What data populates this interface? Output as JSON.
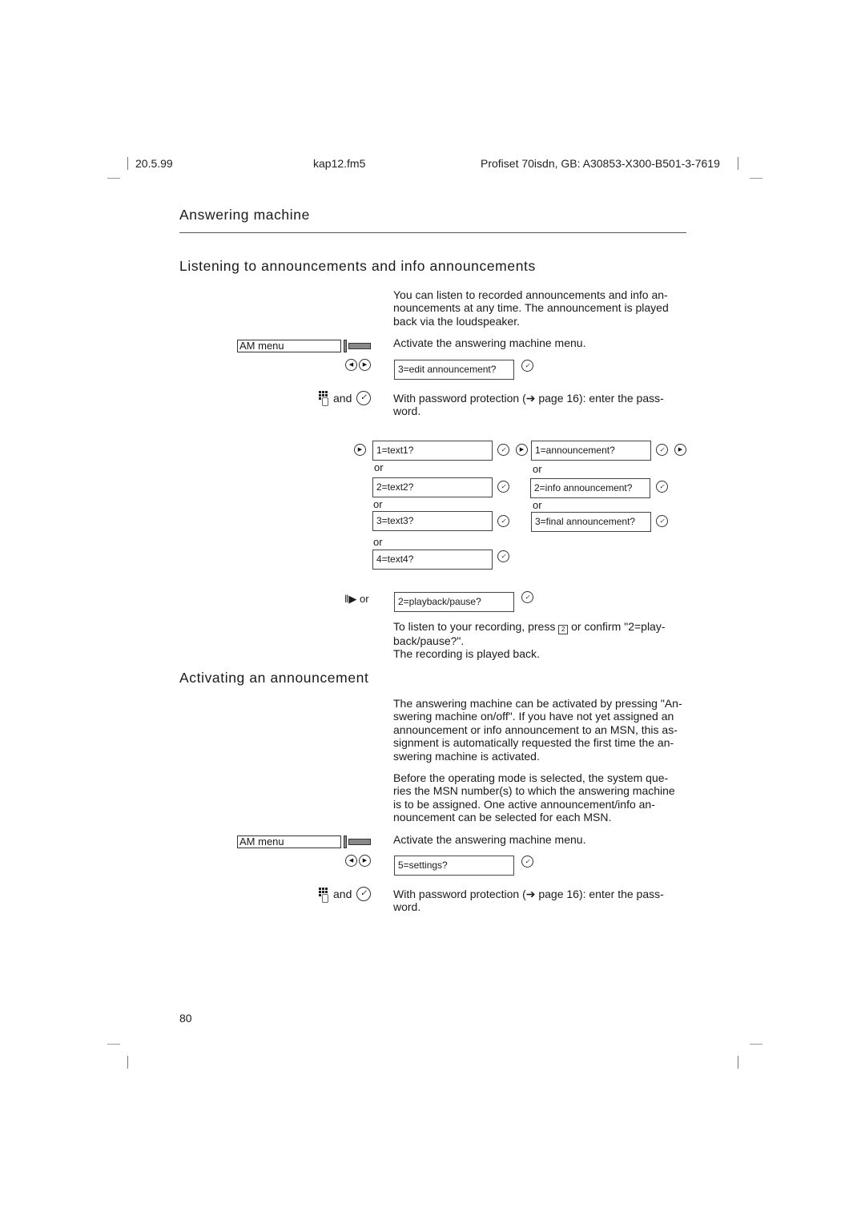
{
  "header": {
    "date": "20.5.99",
    "file": "kap12.fm5",
    "product": "Profiset 70isdn, GB: A30853-X300-B501-3-7619"
  },
  "chapter_title": "Answering machine",
  "section1": {
    "title": "Listening to announcements and info announcements",
    "intro": "You can listen to recorded announcements and info an-nouncements at any time. The announcement is played back via the loudspeaker.",
    "intro_lines": [
      "You can listen to recorded announcements and info an-",
      "nouncements at any time. The announcement is played",
      "back via the loudspeaker."
    ],
    "am_menu_label": "AM menu",
    "activate_text": "Activate the answering machine menu.",
    "display_edit": "3=edit announcement?",
    "and_label": "and",
    "password_lines": [
      "With password protection (➔ page 16): enter the pass-",
      "word."
    ],
    "text_options": [
      "1=text1?",
      "2=text2?",
      "3=text3?",
      "4=text4?"
    ],
    "announcement_options": [
      "1=announcement?",
      "2=info announcement?",
      "3=final announcement?"
    ],
    "or_label": "or",
    "playpause_label": "‖▶ or",
    "display_playback": "2=playback/pause?",
    "listen_line1_a": "To listen to your recording, press",
    "listen_key": "2",
    "listen_line1_b": "or confirm \"2=play-",
    "listen_line2": "back/pause?\".",
    "listen_line3": "The recording is played back."
  },
  "section2": {
    "title": "Activating an announcement",
    "para1_lines": [
      "The answering machine can be activated by pressing \"An-",
      "swering machine on/off\". If you have not yet assigned an",
      "announcement or info announcement to an MSN, this as-",
      "signment is automatically requested the first time the an-",
      "swering machine is activated."
    ],
    "para2_lines": [
      "Before the operating mode is selected, the system que-",
      "ries the MSN number(s) to which the answering machine",
      "is to be assigned. One active announcement/info an-",
      "nouncement can be selected for each MSN."
    ],
    "am_menu_label": "AM menu",
    "activate_text": "Activate the answering machine menu.",
    "display_settings": "5=settings?",
    "and_label": "and",
    "password_lines": [
      "With password protection (➔ page 16): enter the pass-",
      "word."
    ]
  },
  "icons": {
    "ok": "✓",
    "left": "◀",
    "right": "▶"
  },
  "page_number": "80"
}
